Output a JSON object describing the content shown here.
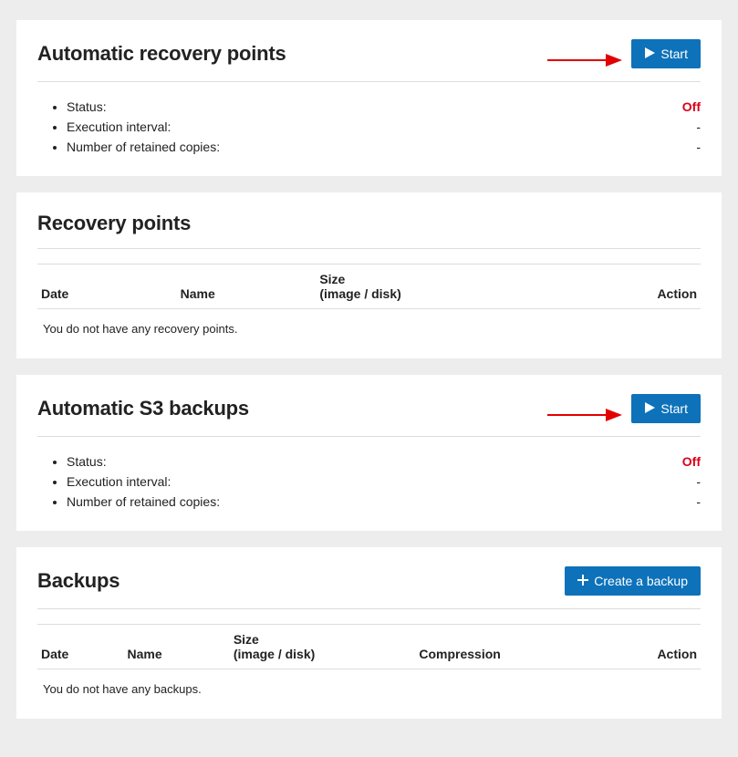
{
  "auto_recovery": {
    "title": "Automatic recovery points",
    "start_btn": "Start",
    "items": [
      {
        "label": "Status:",
        "value": "Off",
        "off": true
      },
      {
        "label": "Execution interval:",
        "value": "-"
      },
      {
        "label": "Number of retained copies:",
        "value": "-"
      }
    ]
  },
  "recovery_points": {
    "title": "Recovery points",
    "cols": {
      "date": "Date",
      "name": "Name",
      "size": "Size\n(image / disk)",
      "action": "Action"
    },
    "empty": "You do not have any recovery points."
  },
  "auto_s3": {
    "title": "Automatic S3 backups",
    "start_btn": "Start",
    "items": [
      {
        "label": "Status:",
        "value": "Off",
        "off": true
      },
      {
        "label": "Execution interval:",
        "value": "-"
      },
      {
        "label": "Number of retained copies:",
        "value": "-"
      }
    ]
  },
  "backups": {
    "title": "Backups",
    "create_btn": "Create a backup",
    "cols": {
      "date": "Date",
      "name": "Name",
      "size": "Size\n(image / disk)",
      "compression": "Compression",
      "action": "Action"
    },
    "empty": "You do not have any backups."
  }
}
